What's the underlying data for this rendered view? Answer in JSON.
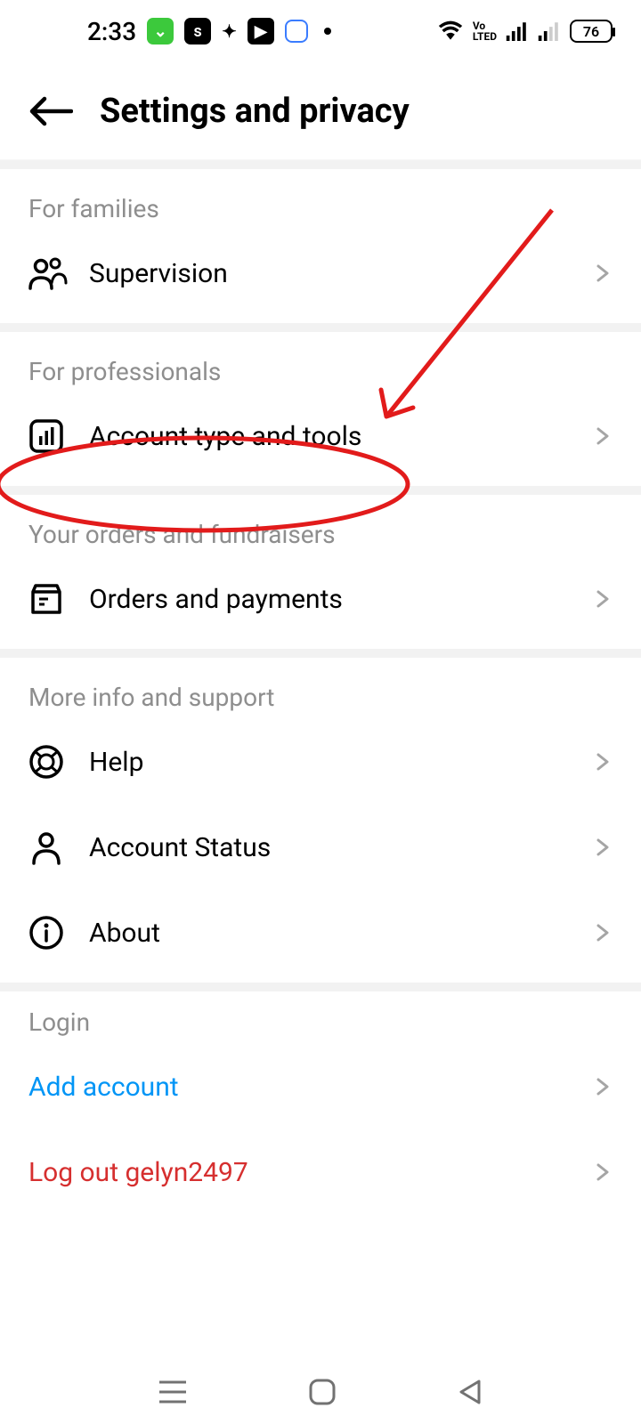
{
  "status": {
    "time": "2:33",
    "battery": "76"
  },
  "header": {
    "title": "Settings and privacy"
  },
  "sections": {
    "families": {
      "title": "For families",
      "supervision": "Supervision"
    },
    "professionals": {
      "title": "For professionals",
      "account_type": "Account type and tools"
    },
    "orders": {
      "title": "Your orders and fundraisers",
      "orders_payments": "Orders and payments"
    },
    "support": {
      "title": "More info and support",
      "help": "Help",
      "account_status": "Account Status",
      "about": "About"
    },
    "login": {
      "title": "Login",
      "add_account": "Add account",
      "logout": "Log out gelyn2497"
    }
  }
}
